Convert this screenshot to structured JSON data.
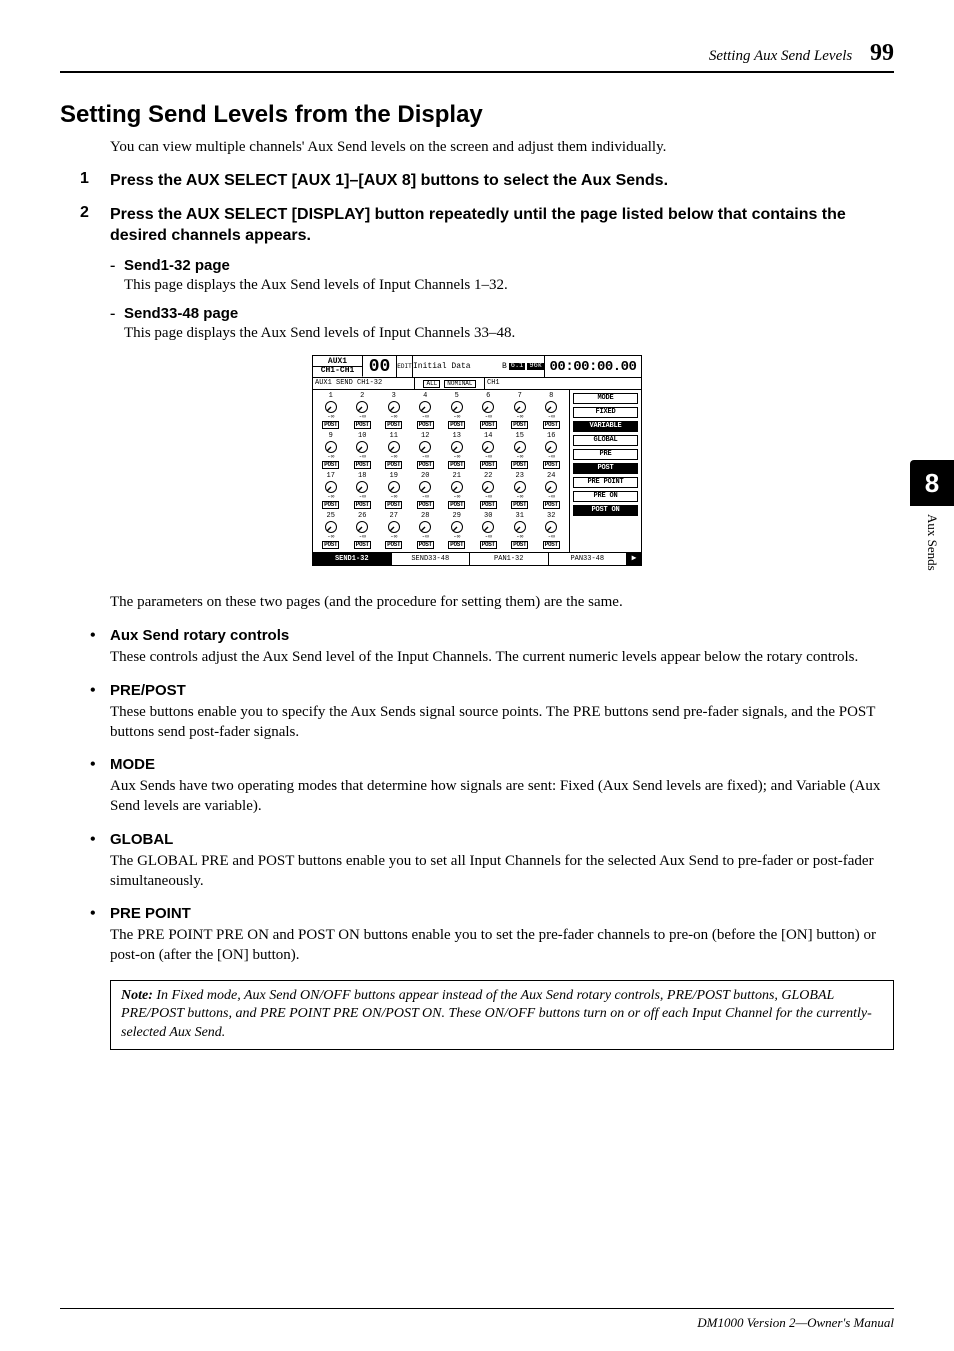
{
  "running_head": {
    "section": "Setting Aux Send Levels",
    "page": "99"
  },
  "title": "Setting Send Levels from the Display",
  "intro": "You can view multiple channels' Aux Send levels on the screen and adjust them individually.",
  "steps": [
    {
      "text": "Press the AUX SELECT [AUX 1]–[AUX 8] buttons to select the Aux Sends."
    },
    {
      "text": "Press the AUX SELECT [DISPLAY] button repeatedly until the page listed below that contains the desired channels appears.",
      "subitems": [
        {
          "head": "Send1-32 page",
          "body": "This page displays the Aux Send levels of Input Channels 1–32."
        },
        {
          "head": "Send33-48 page",
          "body": "This page displays the Aux Send levels of Input Channels 33–48."
        }
      ]
    }
  ],
  "lcd": {
    "aux_top": "AUX1",
    "aux_bottom": "CH1-CH1",
    "big": "00",
    "edit": "EDIT",
    "mid_title": "Initial Data",
    "mid_badge1": "6.1",
    "mid_badge2": "96k",
    "mid_r": "B",
    "clock": "00:00:00.00",
    "row2_a": "AUX1 SEND CH1-32",
    "row2_all": "ALL",
    "row2_nom": "NOMINAL",
    "row2_ch": "CH1",
    "knob_value": "-∞",
    "knob_btn": "POST",
    "right_buttons": [
      "MODE",
      "FIXED",
      "VARIABLE",
      "GLOBAL",
      "PRE",
      "POST",
      "PRE POINT",
      "PRE ON",
      "POST ON"
    ],
    "right_inverted": [
      false,
      false,
      true,
      false,
      false,
      true,
      false,
      false,
      true
    ],
    "tabs": [
      "SEND1-32",
      "SEND33-48",
      "PAN1-32",
      "PAN33-48"
    ],
    "tab_selected": 0
  },
  "after_para": "The parameters on these two pages (and the procedure for setting them) are the same.",
  "bullets": [
    {
      "head": "Aux Send rotary controls",
      "body": "These controls adjust the Aux Send level of the Input Channels. The current numeric levels appear below the rotary controls."
    },
    {
      "head": "PRE/POST",
      "body": "These buttons enable you to specify the Aux Sends signal source points. The PRE buttons send pre-fader signals, and the POST buttons send post-fader signals."
    },
    {
      "head": "MODE",
      "body": "Aux Sends have two operating modes that determine how signals are sent: Fixed (Aux Send levels are fixed); and Variable (Aux Send levels are variable)."
    },
    {
      "head": "GLOBAL",
      "body": "The GLOBAL PRE and POST buttons enable you to set all Input Channels for the selected Aux Send to pre-fader or post-fader simultaneously."
    },
    {
      "head": "PRE POINT",
      "body": "The PRE POINT PRE ON and POST ON buttons enable you to set the pre-fader channels to pre-on (before the [ON] button) or post-on (after the [ON] button)."
    }
  ],
  "note": {
    "label": "Note:",
    "body": "In Fixed mode, Aux Send ON/OFF buttons appear instead of the Aux Send rotary controls, PRE/POST buttons, GLOBAL PRE/POST buttons, and PRE POINT PRE ON/POST ON. These ON/OFF buttons turn on or off each Input Channel for the currently-selected Aux Send."
  },
  "side": {
    "chapter": "8",
    "label": "Aux Sends"
  },
  "footer": "DM1000 Version 2—Owner's Manual"
}
